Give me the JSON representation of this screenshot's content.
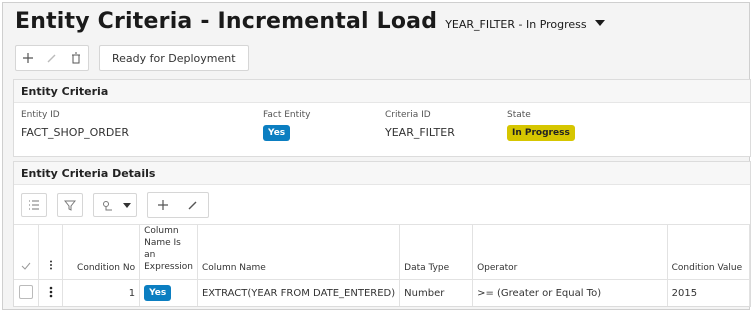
{
  "page": {
    "title": "Entity Criteria - Incremental Load",
    "subtitle": "YEAR_FILTER - In Progress"
  },
  "toolbar": {
    "ready_label": "Ready for Deployment"
  },
  "entity_criteria": {
    "header": "Entity Criteria",
    "entity_id_label": "Entity ID",
    "entity_id_value": "FACT_SHOP_ORDER",
    "fact_entity_label": "Fact Entity",
    "fact_entity_value": "Yes",
    "criteria_id_label": "Criteria ID",
    "criteria_id_value": "YEAR_FILTER",
    "state_label": "State",
    "state_value": "In Progress"
  },
  "details": {
    "header": "Entity Criteria Details",
    "columns": {
      "condition_no": "Condition No",
      "col_expr": "Column Name Is an Expression",
      "column_name": "Column Name",
      "data_type": "Data Type",
      "operator": "Operator",
      "condition_value": "Condition Value"
    },
    "rows": [
      {
        "condition_no": "1",
        "col_expr": "Yes",
        "column_name": "EXTRACT(YEAR FROM DATE_ENTERED)",
        "data_type": "Number",
        "operator": ">= (Greater or Equal To)",
        "condition_value": "2015"
      }
    ]
  },
  "colors": {
    "badge_blue": "#0b7ec1",
    "badge_yellow": "#d6c600"
  }
}
